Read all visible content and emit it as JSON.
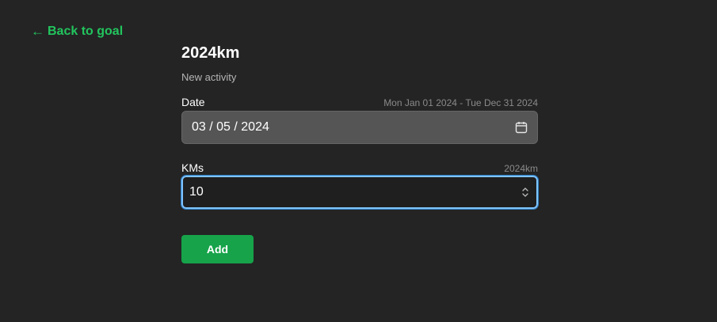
{
  "nav": {
    "back_arrow": "←",
    "back_label": "Back to goal"
  },
  "goal": {
    "title": "2024km",
    "subtitle": "New activity"
  },
  "date": {
    "label": "Date",
    "range_hint": "Mon Jan 01 2024 - Tue Dec 31 2024",
    "value": "03 / 05 / 2024",
    "icon": "calendar-icon"
  },
  "kms": {
    "label": "KMs",
    "hint": "2024km",
    "value": "10",
    "icon": "stepper-icon"
  },
  "actions": {
    "add_label": "Add"
  },
  "colors": {
    "background": "#242424",
    "accent": "#22c55e",
    "button": "#16a34a",
    "focus": "#7fc4ff"
  }
}
